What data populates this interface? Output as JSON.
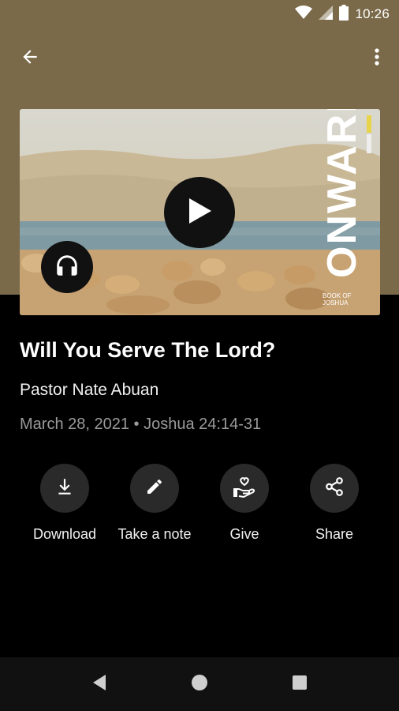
{
  "status_bar": {
    "time": "10:26",
    "icons": [
      "wifi-icon",
      "signal-icon",
      "battery-icon"
    ]
  },
  "app_bar": {
    "back_icon": "arrow-back-icon",
    "more_icon": "more-vert-icon"
  },
  "artwork": {
    "title_text": "ONWARD",
    "subtitle_text": "BOOK OF JOSHUA",
    "play_icon": "play-icon",
    "audio_icon": "headphones-icon"
  },
  "sermon": {
    "title": "Will You Serve The Lord?",
    "speaker": "Pastor Nate Abuan",
    "meta": "March 28, 2021 • Joshua 24:14-31"
  },
  "actions": [
    {
      "label": "Download",
      "icon": "download-icon"
    },
    {
      "label": "Take a note",
      "icon": "pencil-icon"
    },
    {
      "label": "Give",
      "icon": "give-heart-hand-icon"
    },
    {
      "label": "Share",
      "icon": "share-icon"
    }
  ],
  "nav_bar": {
    "icons": [
      "nav-back-icon",
      "nav-home-icon",
      "nav-recents-icon"
    ]
  },
  "colors": {
    "header_band": "#7a6a4a",
    "background": "#000000",
    "button_circle": "#2a2a2a",
    "meta_text": "#9a9a9a",
    "accent_yellow": "#e7d44a"
  }
}
